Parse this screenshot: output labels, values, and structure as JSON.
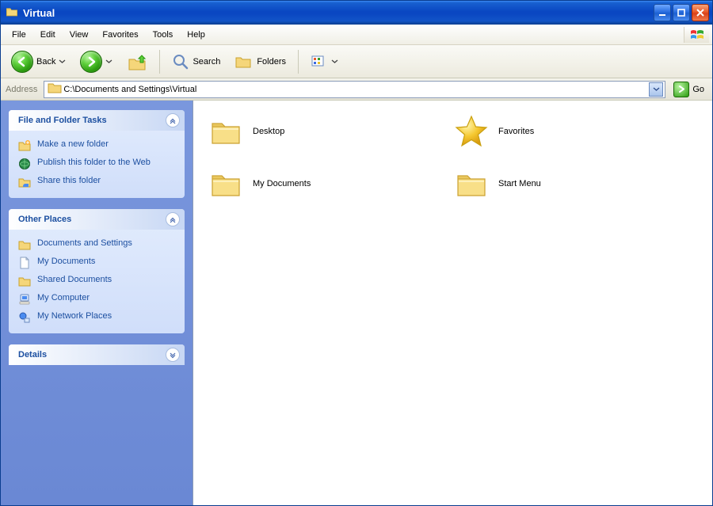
{
  "title": "Virtual",
  "menubar": [
    "File",
    "Edit",
    "View",
    "Favorites",
    "Tools",
    "Help"
  ],
  "toolbar": {
    "back": "Back",
    "search": "Search",
    "folders": "Folders"
  },
  "addressbar": {
    "label": "Address",
    "path": "C:\\Documents and Settings\\Virtual",
    "go": "Go"
  },
  "sidebar": {
    "file_tasks": {
      "title": "File and Folder Tasks",
      "items": [
        {
          "label": "Make a new folder",
          "icon": "new-folder-icon"
        },
        {
          "label": "Publish this folder to the Web",
          "icon": "publish-web-icon"
        },
        {
          "label": "Share this folder",
          "icon": "share-folder-icon"
        }
      ]
    },
    "other_places": {
      "title": "Other Places",
      "items": [
        {
          "label": "Documents and Settings",
          "icon": "folder-icon"
        },
        {
          "label": "My Documents",
          "icon": "document-icon"
        },
        {
          "label": "Shared Documents",
          "icon": "folder-icon"
        },
        {
          "label": "My Computer",
          "icon": "computer-icon"
        },
        {
          "label": "My Network Places",
          "icon": "network-icon"
        }
      ]
    },
    "details": {
      "title": "Details"
    }
  },
  "items": [
    {
      "label": "Desktop",
      "icon": "folder"
    },
    {
      "label": "Favorites",
      "icon": "star"
    },
    {
      "label": "My Documents",
      "icon": "folder"
    },
    {
      "label": "Start Menu",
      "icon": "folder"
    }
  ]
}
